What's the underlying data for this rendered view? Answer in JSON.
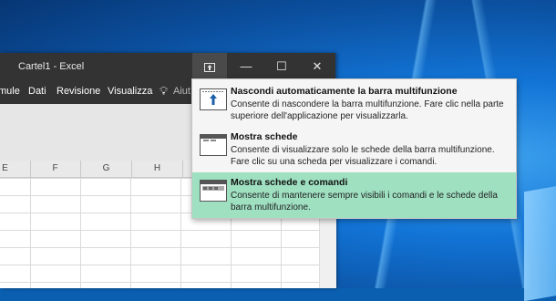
{
  "window": {
    "title": "Cartel1 - Excel",
    "minimize_glyph": "—",
    "maximize_glyph": "☐",
    "close_glyph": "✕"
  },
  "menu": {
    "items": [
      "mule",
      "Dati",
      "Revisione",
      "Visualizza"
    ],
    "tell_me_partial": "Aiut"
  },
  "sheet": {
    "columns": [
      "E",
      "F",
      "G",
      "H"
    ]
  },
  "ribbon_display_options": {
    "selected_index": 2,
    "highlight_color": "#9fe0c1",
    "items": [
      {
        "title": "Nascondi automaticamente la barra multifunzione",
        "description": "Consente di nascondere la barra multifunzione. Fare clic nella parte superiore dell'applicazione per visualizzarla.",
        "icon": "auto-hide-ribbon-icon"
      },
      {
        "title": "Mostra schede",
        "description": "Consente di visualizzare solo le schede della barra multifunzione. Fare clic su una scheda per visualizzare i comandi.",
        "icon": "show-tabs-icon"
      },
      {
        "title": "Mostra schede e comandi",
        "description": "Consente di mantenere sempre visibili i comandi e le schede della barra multifunzione.",
        "icon": "show-tabs-and-commands-icon"
      }
    ]
  }
}
